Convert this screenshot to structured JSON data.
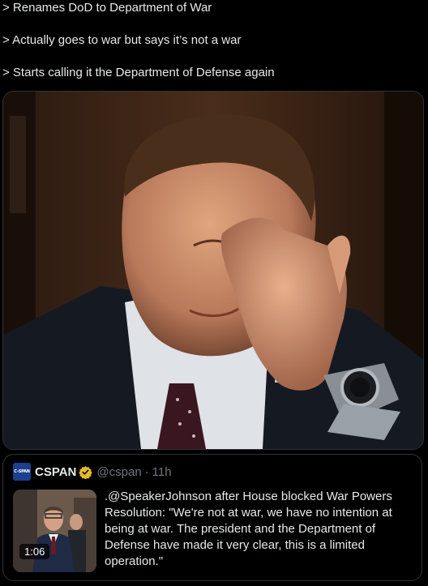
{
  "tweet": {
    "lines": [
      "> Renames DoD to Department of War",
      "> Actually goes to war but says it’s not a war",
      "> Starts calling it the Department of Defense again"
    ]
  },
  "media": {
    "icon": "facepalm-photo"
  },
  "quote": {
    "logo_text": "C-SPAN",
    "display_name": "CSPAN",
    "handle": "@cspan",
    "separator": "·",
    "time": "11h",
    "verified_color": "#e8b829",
    "video_duration": "1:06",
    "text": ".@SpeakerJohnson after House blocked War Powers Resolution: \"We're not at war, we have no intention at being at war. The president and the Department of Defense have made it very clear, this is a limited operation.\""
  },
  "colors": {
    "background": "#000000",
    "text": "#e7e9ea",
    "muted": "#71767b",
    "border": "#2f3336",
    "cspan_blue": "#1d3f8f"
  }
}
